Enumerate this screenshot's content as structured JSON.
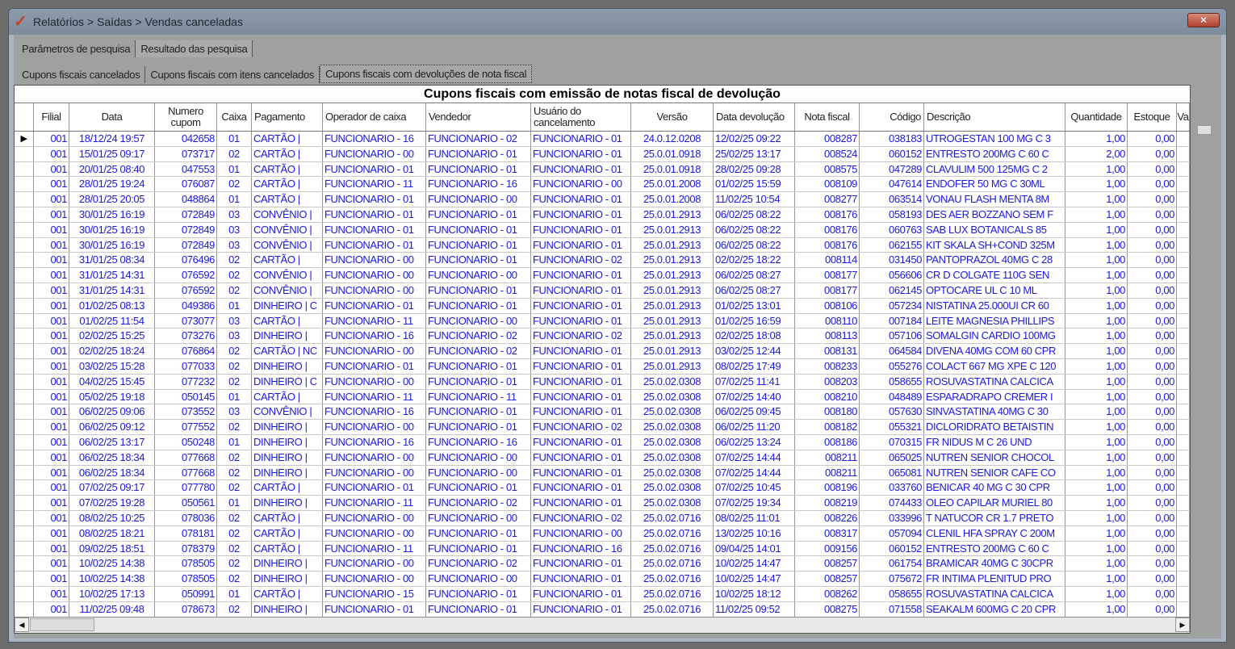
{
  "window": {
    "title": "Relatórios > Saídas > Vendas canceladas",
    "close": "✕"
  },
  "tabs": [
    "Parâmetros de pesquisa",
    "Resultado das pesquisa"
  ],
  "active_tab": 1,
  "subtabs": [
    "Cupons fiscais cancelados",
    "Cupons fiscais com itens cancelados",
    "Cupons fiscais com devoluções de nota fiscal"
  ],
  "active_subtab": 2,
  "grid": {
    "title": "Cupons fiscais com emissão de notas fiscal de devolução",
    "columns": [
      "Filial",
      "Data",
      "Numero cupom",
      "Caixa",
      "Pagamento",
      "Operador de caixa",
      "Vendedor",
      "Usuário do cancelamento",
      "Versão",
      "Data devolução",
      "Nota fiscal",
      "Código",
      "Descrição",
      "Quantidade",
      "Estoque",
      "Va"
    ],
    "selected_row": 0,
    "rows": [
      [
        "001",
        "18/12/24 19:57",
        "042658",
        "01",
        "CARTÃO |",
        "FUNCIONARIO - 16",
        "FUNCIONARIO - 02",
        "FUNCIONARIO - 01",
        "24.0.12.0208",
        "12/02/25 09:22",
        "008287",
        "038183",
        "UTROGESTAN 100 MG C 3",
        "1,00",
        "0,00"
      ],
      [
        "001",
        "15/01/25 09:17",
        "073717",
        "02",
        "CARTÃO |",
        "FUNCIONARIO - 00",
        "FUNCIONARIO - 01",
        "FUNCIONARIO - 01",
        "25.0.01.0918",
        "25/02/25 13:17",
        "008524",
        "060152",
        "ENTRESTO 200MG C 60 C",
        "2,00",
        "0,00"
      ],
      [
        "001",
        "20/01/25 08:40",
        "047553",
        "01",
        "CARTÃO |",
        "FUNCIONARIO - 01",
        "FUNCIONARIO - 01",
        "FUNCIONARIO - 01",
        "25.0.01.0918",
        "28/02/25 09:28",
        "008575",
        "047289",
        "CLAVULIM 500 125MG C 2",
        "1,00",
        "0,00"
      ],
      [
        "001",
        "28/01/25 19:24",
        "076087",
        "02",
        "CARTÃO |",
        "FUNCIONARIO - 11",
        "FUNCIONARIO - 16",
        "FUNCIONARIO - 00",
        "25.0.01.2008",
        "01/02/25 15:59",
        "008109",
        "047614",
        "ENDOFER  50 MG C  30ML",
        "1,00",
        "0,00"
      ],
      [
        "001",
        "28/01/25 20:05",
        "048864",
        "01",
        "CARTÃO |",
        "FUNCIONARIO - 01",
        "FUNCIONARIO - 00",
        "FUNCIONARIO - 01",
        "25.0.01.2008",
        "11/02/25 10:54",
        "008277",
        "063514",
        "VONAU FLASH MENTA 8M",
        "1,00",
        "0,00"
      ],
      [
        "001",
        "30/01/25 16:19",
        "072849",
        "03",
        "CONVÊNIO |",
        "FUNCIONARIO - 01",
        "FUNCIONARIO - 01",
        "FUNCIONARIO - 01",
        "25.0.01.2913",
        "06/02/25 08:22",
        "008176",
        "058193",
        "DES AER BOZZANO SEM F",
        "1,00",
        "0,00"
      ],
      [
        "001",
        "30/01/25 16:19",
        "072849",
        "03",
        "CONVÊNIO |",
        "FUNCIONARIO - 01",
        "FUNCIONARIO - 01",
        "FUNCIONARIO - 01",
        "25.0.01.2913",
        "06/02/25 08:22",
        "008176",
        "060763",
        "SAB LUX BOTANICALS 85",
        "1,00",
        "0,00"
      ],
      [
        "001",
        "30/01/25 16:19",
        "072849",
        "03",
        "CONVÊNIO |",
        "FUNCIONARIO - 01",
        "FUNCIONARIO - 01",
        "FUNCIONARIO - 01",
        "25.0.01.2913",
        "06/02/25 08:22",
        "008176",
        "062155",
        "KIT SKALA SH+COND 325M",
        "1,00",
        "0,00"
      ],
      [
        "001",
        "31/01/25 08:34",
        "076496",
        "02",
        "CARTÃO |",
        "FUNCIONARIO - 00",
        "FUNCIONARIO - 01",
        "FUNCIONARIO - 02",
        "25.0.01.2913",
        "02/02/25 18:22",
        "008114",
        "031450",
        "PANTOPRAZOL 40MG C 28",
        "1,00",
        "0,00"
      ],
      [
        "001",
        "31/01/25 14:31",
        "076592",
        "02",
        "CONVÊNIO |",
        "FUNCIONARIO - 00",
        "FUNCIONARIO - 00",
        "FUNCIONARIO - 01",
        "25.0.01.2913",
        "06/02/25 08:27",
        "008177",
        "056606",
        "CR D COLGATE  110G SEN",
        "1,00",
        "0,00"
      ],
      [
        "001",
        "31/01/25 14:31",
        "076592",
        "02",
        "CONVÊNIO |",
        "FUNCIONARIO - 00",
        "FUNCIONARIO - 01",
        "FUNCIONARIO - 01",
        "25.0.01.2913",
        "06/02/25 08:27",
        "008177",
        "062145",
        "OPTOCARE UL C 10 ML",
        "1,00",
        "0,00"
      ],
      [
        "001",
        "01/02/25 08:13",
        "049386",
        "01",
        "DINHEIRO | C",
        "FUNCIONARIO - 01",
        "FUNCIONARIO - 01",
        "FUNCIONARIO - 01",
        "25.0.01.2913",
        "01/02/25 13:01",
        "008106",
        "057234",
        "NISTATINA 25.000UI CR 60",
        "1,00",
        "0,00"
      ],
      [
        "001",
        "01/02/25 11:54",
        "073077",
        "03",
        "CARTÃO |",
        "FUNCIONARIO - 11",
        "FUNCIONARIO - 00",
        "FUNCIONARIO - 01",
        "25.0.01.2913",
        "01/02/25 16:59",
        "008110",
        "007184",
        "LEITE MAGNESIA PHILLIPS",
        "1,00",
        "0,00"
      ],
      [
        "001",
        "02/02/25 15:25",
        "073276",
        "03",
        "DINHEIRO |",
        "FUNCIONARIO - 16",
        "FUNCIONARIO - 02",
        "FUNCIONARIO - 02",
        "25.0.01.2913",
        "02/02/25 18:08",
        "008113",
        "057106",
        "SOMALGIN CARDIO 100MG",
        "1,00",
        "0,00"
      ],
      [
        "001",
        "02/02/25 18:24",
        "076864",
        "02",
        "CARTÃO | NC",
        "FUNCIONARIO - 00",
        "FUNCIONARIO - 02",
        "FUNCIONARIO - 01",
        "25.0.01.2913",
        "03/02/25 12:44",
        "008131",
        "064584",
        "DIVENA 40MG COM 60 CPR",
        "1,00",
        "0,00"
      ],
      [
        "001",
        "03/02/25 15:28",
        "077033",
        "02",
        "DINHEIRO |",
        "FUNCIONARIO - 01",
        "FUNCIONARIO - 01",
        "FUNCIONARIO - 01",
        "25.0.01.2913",
        "08/02/25 17:49",
        "008233",
        "055276",
        "COLACT 667 MG XPE C 120",
        "1,00",
        "0,00"
      ],
      [
        "001",
        "04/02/25 15:45",
        "077232",
        "02",
        "DINHEIRO | C",
        "FUNCIONARIO - 00",
        "FUNCIONARIO - 01",
        "FUNCIONARIO - 01",
        "25.0.02.0308",
        "07/02/25 11:41",
        "008203",
        "058655",
        "ROSUVASTATINA CALCICA",
        "1,00",
        "0,00"
      ],
      [
        "001",
        "05/02/25 19:18",
        "050145",
        "01",
        "CARTÃO |",
        "FUNCIONARIO - 11",
        "FUNCIONARIO - 11",
        "FUNCIONARIO - 01",
        "25.0.02.0308",
        "07/02/25 14:40",
        "008210",
        "048489",
        "ESPARADRAPO CREMER I",
        "1,00",
        "0,00"
      ],
      [
        "001",
        "06/02/25 09:06",
        "073552",
        "03",
        "CONVÊNIO |",
        "FUNCIONARIO - 16",
        "FUNCIONARIO - 01",
        "FUNCIONARIO - 01",
        "25.0.02.0308",
        "06/02/25 09:45",
        "008180",
        "057630",
        "SINVASTATINA 40MG C 30",
        "1,00",
        "0,00"
      ],
      [
        "001",
        "06/02/25 09:12",
        "077552",
        "02",
        "DINHEIRO |",
        "FUNCIONARIO - 00",
        "FUNCIONARIO - 01",
        "FUNCIONARIO - 02",
        "25.0.02.0308",
        "06/02/25 11:20",
        "008182",
        "055321",
        "DICLORIDRATO BETAISTIN",
        "1,00",
        "0,00"
      ],
      [
        "001",
        "06/02/25 13:17",
        "050248",
        "01",
        "DINHEIRO |",
        "FUNCIONARIO - 16",
        "FUNCIONARIO - 16",
        "FUNCIONARIO - 01",
        "25.0.02.0308",
        "06/02/25 13:24",
        "008186",
        "070315",
        "FR NIDUS M C 26 UND",
        "1,00",
        "0,00"
      ],
      [
        "001",
        "06/02/25 18:34",
        "077668",
        "02",
        "DINHEIRO |",
        "FUNCIONARIO - 00",
        "FUNCIONARIO - 00",
        "FUNCIONARIO - 01",
        "25.0.02.0308",
        "07/02/25 14:44",
        "008211",
        "065025",
        "NUTREN SENIOR CHOCOL",
        "1,00",
        "0,00"
      ],
      [
        "001",
        "06/02/25 18:34",
        "077668",
        "02",
        "DINHEIRO |",
        "FUNCIONARIO - 00",
        "FUNCIONARIO - 00",
        "FUNCIONARIO - 01",
        "25.0.02.0308",
        "07/02/25 14:44",
        "008211",
        "065081",
        "NUTREN SENIOR CAFE CO",
        "1,00",
        "0,00"
      ],
      [
        "001",
        "07/02/25 09:17",
        "077780",
        "02",
        "CARTÃO |",
        "FUNCIONARIO - 01",
        "FUNCIONARIO - 01",
        "FUNCIONARIO - 01",
        "25.0.02.0308",
        "07/02/25 10:45",
        "008196",
        "033760",
        "BENICAR 40 MG C 30 CPR",
        "1,00",
        "0,00"
      ],
      [
        "001",
        "07/02/25 19:28",
        "050561",
        "01",
        "DINHEIRO |",
        "FUNCIONARIO - 11",
        "FUNCIONARIO - 02",
        "FUNCIONARIO - 01",
        "25.0.02.0308",
        "07/02/25 19:34",
        "008219",
        "074433",
        "OLEO CAPILAR MURIEL 80",
        "1,00",
        "0,00"
      ],
      [
        "001",
        "08/02/25 10:25",
        "078036",
        "02",
        "CARTÃO |",
        "FUNCIONARIO - 00",
        "FUNCIONARIO - 00",
        "FUNCIONARIO - 02",
        "25.0.02.0716",
        "08/02/25 11:01",
        "008226",
        "033996",
        "T NATUCOR CR 1.7 PRETO",
        "1,00",
        "0,00"
      ],
      [
        "001",
        "08/02/25 18:21",
        "078181",
        "02",
        "CARTÃO |",
        "FUNCIONARIO - 00",
        "FUNCIONARIO - 01",
        "FUNCIONARIO - 00",
        "25.0.02.0716",
        "13/02/25 10:16",
        "008317",
        "057094",
        "CLENIL HFA SPRAY C 200M",
        "1,00",
        "0,00"
      ],
      [
        "001",
        "09/02/25 18:51",
        "078379",
        "02",
        "CARTÃO |",
        "FUNCIONARIO - 11",
        "FUNCIONARIO - 01",
        "FUNCIONARIO - 16",
        "25.0.02.0716",
        "09/04/25 14:01",
        "009156",
        "060152",
        "ENTRESTO 200MG C 60 C",
        "1,00",
        "0,00"
      ],
      [
        "001",
        "10/02/25 14:38",
        "078505",
        "02",
        "DINHEIRO |",
        "FUNCIONARIO - 00",
        "FUNCIONARIO - 02",
        "FUNCIONARIO - 01",
        "25.0.02.0716",
        "10/02/25 14:47",
        "008257",
        "061754",
        "BRAMICAR 40MG C  30CPR",
        "1,00",
        "0,00"
      ],
      [
        "001",
        "10/02/25 14:38",
        "078505",
        "02",
        "DINHEIRO |",
        "FUNCIONARIO - 00",
        "FUNCIONARIO - 00",
        "FUNCIONARIO - 01",
        "25.0.02.0716",
        "10/02/25 14:47",
        "008257",
        "075672",
        "FR INTIMA PLENITUD PRO",
        "1,00",
        "0,00"
      ],
      [
        "001",
        "10/02/25 17:13",
        "050991",
        "01",
        "CARTÃO |",
        "FUNCIONARIO - 15",
        "FUNCIONARIO - 01",
        "FUNCIONARIO - 01",
        "25.0.02.0716",
        "10/02/25 18:12",
        "008262",
        "058655",
        "ROSUVASTATINA CALCICA",
        "1,00",
        "0,00"
      ],
      [
        "001",
        "11/02/25 09:48",
        "078673",
        "02",
        "DINHEIRO |",
        "FUNCIONARIO - 01",
        "FUNCIONARIO - 01",
        "FUNCIONARIO - 01",
        "25.0.02.0716",
        "11/02/25 09:52",
        "008275",
        "071558",
        "SEAKALM 600MG C 20 CPR",
        "1,00",
        "0,00"
      ]
    ]
  },
  "scrollbar": {
    "left": "◀",
    "right": "▶"
  },
  "row_indicator": "▶"
}
